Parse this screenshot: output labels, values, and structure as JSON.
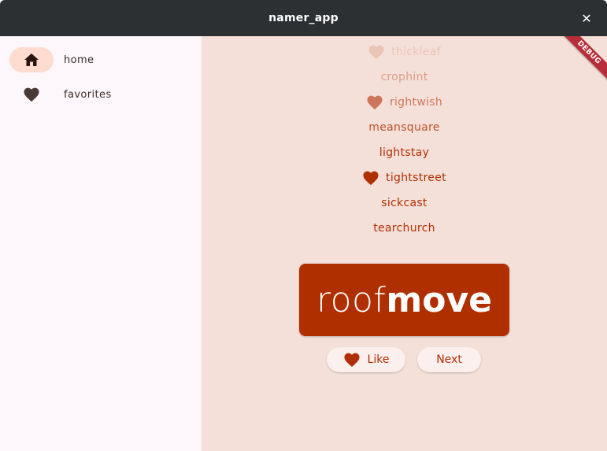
{
  "window": {
    "title": "namer_app",
    "close_label": "✕"
  },
  "rail": {
    "items": [
      {
        "label": "home",
        "icon": "home-icon",
        "selected": true
      },
      {
        "label": "favorites",
        "icon": "heart-icon",
        "selected": false
      }
    ]
  },
  "history": [
    {
      "word": "thickleaf",
      "favorite": true
    },
    {
      "word": "crophint",
      "favorite": false
    },
    {
      "word": "rightwish",
      "favorite": true
    },
    {
      "word": "meansquare",
      "favorite": false
    },
    {
      "word": "lightstay",
      "favorite": false
    },
    {
      "word": "tightstreet",
      "favorite": true
    },
    {
      "word": "sickcast",
      "favorite": false
    },
    {
      "word": "tearchurch",
      "favorite": false
    }
  ],
  "current_pair": {
    "first": "roof",
    "second": "move"
  },
  "buttons": {
    "like_label": "Like",
    "next_label": "Next"
  },
  "debug_banner": "DEBUG",
  "colors": {
    "primary": "#b02f00",
    "main_bg": "#f5dfd9",
    "rail_selected": "#ffdbd0",
    "titlebar": "#2c3033"
  }
}
